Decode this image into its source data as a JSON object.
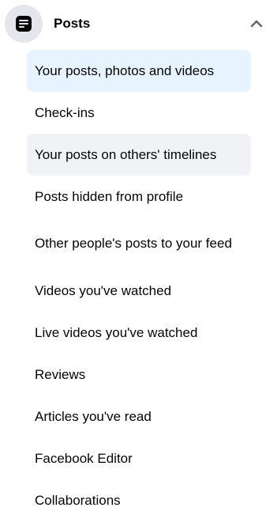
{
  "section": {
    "title": "Posts",
    "icon": "posts-icon",
    "collapse_icon": "chevron-up-icon"
  },
  "colors": {
    "selected_bg": "#e7f3ff",
    "hover_bg": "#f0f2f5",
    "icon_circle_bg": "#e4e6eb",
    "text": "#050505"
  },
  "items": [
    {
      "label": "Your posts, photos and videos",
      "state": "selected"
    },
    {
      "label": "Check-ins",
      "state": "normal"
    },
    {
      "label": "Your posts on others' timelines",
      "state": "hover"
    },
    {
      "label": "Posts hidden from profile",
      "state": "normal"
    },
    {
      "label": "Other people's posts to your feed",
      "state": "normal"
    },
    {
      "label": "Videos you've watched",
      "state": "normal"
    },
    {
      "label": "Live videos you've watched",
      "state": "normal"
    },
    {
      "label": "Reviews",
      "state": "normal"
    },
    {
      "label": "Articles you've read",
      "state": "normal"
    },
    {
      "label": "Facebook Editor",
      "state": "normal"
    },
    {
      "label": "Collaborations",
      "state": "normal"
    }
  ]
}
